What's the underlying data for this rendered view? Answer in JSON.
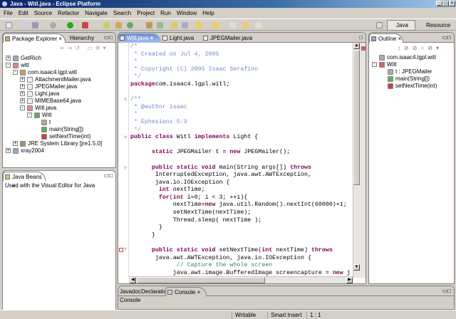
{
  "window": {
    "title": "Java - Witl.java - Eclipse Platform",
    "min": "_",
    "max": "□",
    "close": "×"
  },
  "menu": [
    "File",
    "Edit",
    "Source",
    "Refactor",
    "Navigate",
    "Search",
    "Project",
    "Run",
    "Window",
    "Help"
  ],
  "perspectives": {
    "java": "Java",
    "resource": "Resource"
  },
  "left": {
    "tabs": [
      "Package Explorer",
      "Hierarchy"
    ],
    "close": "×",
    "tree": [
      {
        "label": "GetRich",
        "depth": 0,
        "exp": "+",
        "icon": "project-icon",
        "color": "#9ab"
      },
      {
        "label": "witl",
        "depth": 0,
        "exp": "-",
        "icon": "project-icon",
        "color": "#c88"
      },
      {
        "label": "com.isaac4.lgpl.witl",
        "depth": 1,
        "exp": "-",
        "icon": "package-icon",
        "color": "#c96"
      },
      {
        "label": "AttachmentMailer.java",
        "depth": 2,
        "exp": "+",
        "icon": "java-file-icon",
        "color": "#eee"
      },
      {
        "label": "JPEGMailer.java",
        "depth": 2,
        "exp": "+",
        "icon": "java-file-icon",
        "color": "#eee"
      },
      {
        "label": "Light.java",
        "depth": 2,
        "exp": "+",
        "icon": "java-file-icon",
        "color": "#eee"
      },
      {
        "label": "MIMEBase64.java",
        "depth": 2,
        "exp": "+",
        "icon": "java-file-icon",
        "color": "#eee"
      },
      {
        "label": "Witl.java",
        "depth": 2,
        "exp": "-",
        "icon": "java-file-icon",
        "color": "#d88"
      },
      {
        "label": "Witl",
        "depth": 3,
        "exp": "-",
        "icon": "class-icon",
        "color": "#6a6"
      },
      {
        "label": "t",
        "depth": 4,
        "exp": "",
        "icon": "field-icon",
        "color": "#aaa"
      },
      {
        "label": "main(String[])",
        "depth": 4,
        "exp": "",
        "icon": "method-icon",
        "color": "#6a6"
      },
      {
        "label": "setNextTime(int)",
        "depth": 4,
        "exp": "",
        "icon": "method-icon",
        "color": "#c44"
      },
      {
        "label": "JRE System Library [jre1.5.0]",
        "depth": 1,
        "exp": "+",
        "icon": "library-icon",
        "color": "#996"
      },
      {
        "label": "xray2004",
        "depth": 0,
        "exp": "+",
        "icon": "project-icon",
        "color": "#9ab"
      }
    ]
  },
  "beans": {
    "tab": "Java Beans",
    "close": "×",
    "text": "Used with the Visual Editor for Java"
  },
  "editor": {
    "tabs": [
      "Witl.java",
      "Light.java",
      "JPEGMailer.java"
    ],
    "close": "×",
    "lines": [
      [
        [
          "c",
          "/*"
        ]
      ],
      [
        [
          "c",
          " * Created on Jul 4, 2005"
        ]
      ],
      [
        [
          "c",
          " *"
        ]
      ],
      [
        [
          "c",
          " * Copyright (C) 2005 Isaac Serafino"
        ]
      ],
      [
        [
          "c",
          " */"
        ]
      ],
      [
        [
          "k",
          "package"
        ],
        [
          "",
          "com.isaac4.lgpl.witl;"
        ]
      ],
      [
        [
          "",
          ""
        ]
      ],
      [
        [
          "c",
          "/**"
        ]
      ],
      [
        [
          "c",
          " * @author isaac"
        ]
      ],
      [
        [
          "c",
          " *"
        ]
      ],
      [
        [
          "c",
          " * Ephesians 5:3"
        ]
      ],
      [
        [
          "c",
          " */"
        ]
      ],
      [
        [
          "k",
          "public class"
        ],
        [
          "",
          " Witl "
        ],
        [
          "k",
          "implements"
        ],
        [
          "",
          " Light {"
        ]
      ],
      [
        [
          "",
          ""
        ]
      ],
      [
        [
          "",
          "      "
        ],
        [
          "k",
          "static"
        ],
        [
          "",
          " JPEGMailer t = "
        ],
        [
          "k",
          "new"
        ],
        [
          "",
          " JPEGMailer();"
        ]
      ],
      [
        [
          "",
          ""
        ]
      ],
      [
        [
          "",
          "      "
        ],
        [
          "k",
          "public static void"
        ],
        [
          "",
          " main(String args[]) "
        ],
        [
          "k",
          "throws"
        ]
      ],
      [
        [
          "",
          "       InterruptedException, java.awt.AWTException,"
        ]
      ],
      [
        [
          "",
          "       java.io.IOException {"
        ]
      ],
      [
        [
          "",
          "        "
        ],
        [
          "k",
          "int"
        ],
        [
          "",
          " nextTime;"
        ]
      ],
      [
        [
          "",
          "        "
        ],
        [
          "k",
          "for"
        ],
        [
          "",
          "("
        ],
        [
          "k",
          "int"
        ],
        [
          "",
          " i=0; i < 3; ++i){"
        ]
      ],
      [
        [
          "",
          "            nextTime="
        ],
        [
          "k",
          "new"
        ],
        [
          "",
          " java.util.Random().nextInt(60000)+1;"
        ]
      ],
      [
        [
          "",
          "            setNextTime(nextTime);"
        ]
      ],
      [
        [
          "",
          "            Thread.sleep( nextTime );"
        ]
      ],
      [
        [
          "",
          "        }"
        ]
      ],
      [
        [
          "",
          "      }"
        ]
      ],
      [
        [
          "",
          ""
        ]
      ],
      [
        [
          "",
          "      "
        ],
        [
          "k",
          "public static void"
        ],
        [
          "",
          " setNextTime("
        ],
        [
          "k",
          "int"
        ],
        [
          "",
          " nextTime) "
        ],
        [
          "k",
          "throws"
        ]
      ],
      [
        [
          "",
          "       java.awt.AWTException, java.io.IOException {"
        ]
      ],
      [
        [
          "cm",
          "             // Capture the whole screen"
        ]
      ],
      [
        [
          "",
          "            java.awt.image.BufferedImage screencapture = "
        ],
        [
          "k",
          "new"
        ],
        [
          "",
          " j"
        ]
      ]
    ]
  },
  "outline": {
    "tab": "Outline",
    "close": "×",
    "items": [
      {
        "label": "com.isaac4.lgpl.witl",
        "depth": 0,
        "color": "#aaa"
      },
      {
        "label": "Witl",
        "depth": 0,
        "color": "#c66"
      },
      {
        "label": "t : JPEGMailer",
        "depth": 1,
        "color": "#aaa"
      },
      {
        "label": "main(String[])",
        "depth": 1,
        "color": "#6a6"
      },
      {
        "label": "setNextTime(int)",
        "depth": 1,
        "color": "#c44"
      }
    ]
  },
  "bottom": {
    "tabs": [
      "Javadoc",
      "Declaration",
      "Console"
    ],
    "close": "×",
    "console_title": "Console"
  },
  "status": {
    "writable": "Writable",
    "insert": "Smart Insert",
    "position": "1 : 1"
  }
}
